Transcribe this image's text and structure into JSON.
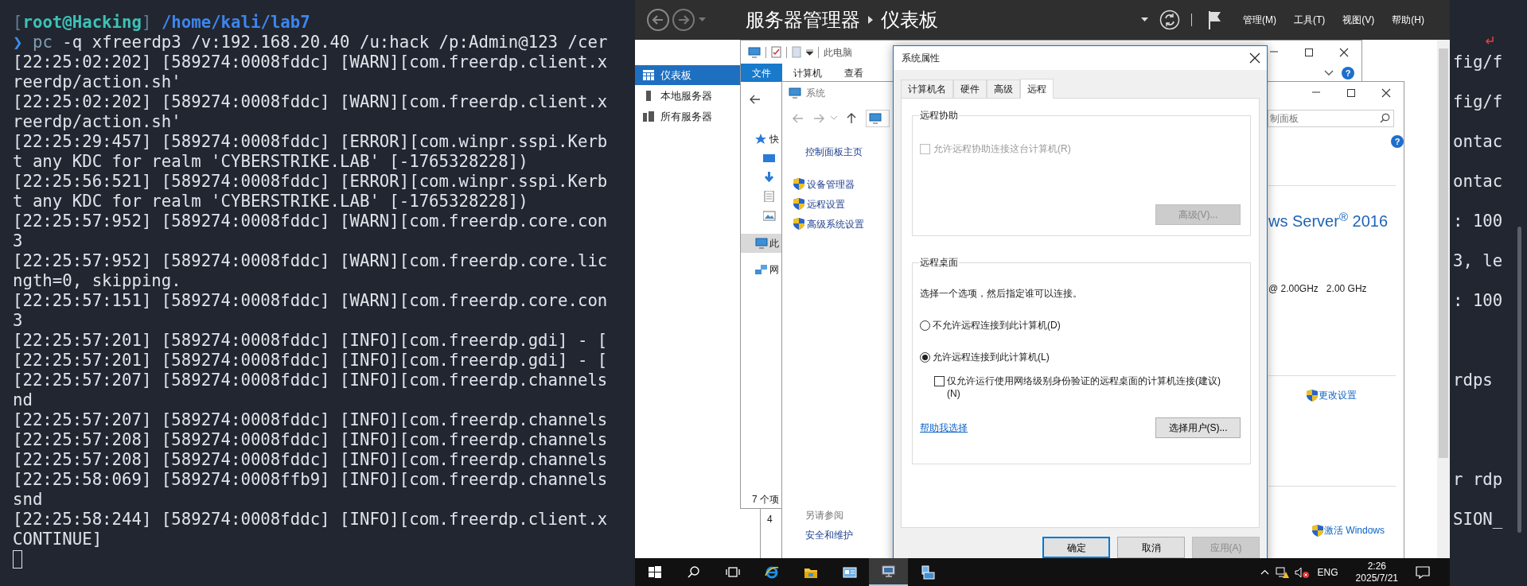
{
  "terminal": {
    "prompt": {
      "open": "[",
      "user": "root@Hacking",
      "close": "]",
      "path": "/home/kali/lab7"
    },
    "command": {
      "symbol": "❯",
      "program": "pc",
      "args": "-q xfreerdp3 /v:192.168.20.40 /u:hack /p:Admin@123 /cer"
    },
    "lines": [
      {
        "text": "[22:25:02:202] [589274:0008fddc] [WARN][com.freerdp.client.x",
        "right": "fig/f"
      },
      {
        "text": "reerdp/action.sh'"
      },
      {
        "text": "[22:25:02:202] [589274:0008fddc] [WARN][com.freerdp.client.x",
        "right": "fig/f"
      },
      {
        "text": "reerdp/action.sh'"
      },
      {
        "text": "[22:25:29:457] [589274:0008fddc] [ERROR][com.winpr.sspi.Kerb",
        "right": "ontac"
      },
      {
        "text": "t any KDC for realm 'CYBERSTRIKE.LAB' [-1765328228])"
      },
      {
        "text": "[22:25:56:521] [589274:0008fddc] [ERROR][com.winpr.sspi.Kerb",
        "right": "ontac"
      },
      {
        "text": "t any KDC for realm 'CYBERSTRIKE.LAB' [-1765328228])"
      },
      {
        "text": "[22:25:57:952] [589274:0008fddc] [WARN][com.freerdp.core.con",
        "right": ": 100"
      },
      {
        "text": "3"
      },
      {
        "text": "[22:25:57:952] [589274:0008fddc] [WARN][com.freerdp.core.lic",
        "right": "3, le"
      },
      {
        "text": "ngth=0, skipping."
      },
      {
        "text": "[22:25:57:151] [589274:0008fddc] [WARN][com.freerdp.core.con",
        "right": ": 100"
      },
      {
        "text": "3"
      },
      {
        "text": "[22:25:57:201] [589274:0008fddc] [INFO][com.freerdp.gdi] - ["
      },
      {
        "text": "[22:25:57:201] [589274:0008fddc] [INFO][com.freerdp.gdi] - ["
      },
      {
        "text": "[22:25:57:207] [589274:0008fddc] [INFO][com.freerdp.channels",
        "right": "rdps"
      },
      {
        "text": "nd"
      },
      {
        "text": "[22:25:57:207] [589274:0008fddc] [INFO][com.freerdp.channels"
      },
      {
        "text": "[22:25:57:208] [589274:0008fddc] [INFO][com.freerdp.channels"
      },
      {
        "text": "[22:25:57:208] [589274:0008fddc] [INFO][com.freerdp.channels"
      },
      {
        "text": "[22:25:58:069] [589274:0008ffb9] [INFO][com.freerdp.channels",
        "right": "r rdp"
      },
      {
        "text": "snd"
      },
      {
        "text": "[22:25:58:244] [589274:0008fddc] [INFO][com.freerdp.client.x",
        "right": "SION_"
      },
      {
        "text": "CONTINUE]"
      }
    ]
  },
  "server_manager": {
    "title": "服务器管理器",
    "page": "仪表板",
    "menus": [
      "管理(M)",
      "工具(T)",
      "视图(V)",
      "帮助(H)"
    ],
    "nav": [
      {
        "label": "仪表板",
        "kind": "dashboard",
        "selected": true
      },
      {
        "label": "本地服务器",
        "kind": "server",
        "selected": false
      },
      {
        "label": "所有服务器",
        "kind": "servers",
        "selected": false
      }
    ]
  },
  "behind_window": {
    "text": "4"
  },
  "explorer": {
    "title": "此电脑",
    "ribbon_tabs": [
      {
        "label": "文件",
        "selected": true
      },
      {
        "label": "计算机",
        "selected": false
      },
      {
        "label": "查看",
        "selected": false
      }
    ],
    "nav_items": [
      {
        "kind": "quick",
        "label": "快",
        "selected": false
      },
      {
        "kind": "desktop",
        "selected": false
      },
      {
        "kind": "downloads",
        "selected": false
      },
      {
        "kind": "documents",
        "selected": false
      },
      {
        "kind": "pictures",
        "selected": false
      },
      {
        "kind": "pc",
        "label": "此",
        "selected": true
      },
      {
        "kind": "network",
        "label": "网",
        "selected": false
      }
    ],
    "help": "?",
    "status": "7 个项"
  },
  "system_window": {
    "title": "系统",
    "search_placeholder": "制面板",
    "home_link": "控制面板主页",
    "tasks": [
      "设备管理器",
      "远程设置",
      "高级系统设置"
    ],
    "see_also_title": "另请参阅",
    "see_also": [
      "安全和维护"
    ],
    "help": "?",
    "edition": "ws Server$^{®}$ 2016",
    "cpu": "@ 2.00GHz   2.00 GHz",
    "change_settings": "更改设置",
    "activate": "激活 Windows"
  },
  "dialog": {
    "title": "系统属性",
    "tabs": [
      {
        "label": "计算机名",
        "selected": false
      },
      {
        "label": "硬件",
        "selected": false
      },
      {
        "label": "高级",
        "selected": false
      },
      {
        "label": "远程",
        "selected": true
      }
    ],
    "remote_assistance": {
      "legend": "远程协助",
      "checkbox": {
        "label": "允许远程协助连接这台计算机(R)",
        "checked": false,
        "disabled": true
      },
      "advanced_button": {
        "label": "高级(V)...",
        "disabled": true
      }
    },
    "remote_desktop": {
      "legend": "远程桌面",
      "hint": "选择一个选项，然后指定谁可以连接。",
      "options": [
        {
          "label": "不允许远程连接到此计算机(D)",
          "selected": false
        },
        {
          "label": "允许远程连接到此计算机(L)",
          "selected": true
        }
      ],
      "nla": {
        "label": "仅允许运行使用网络级别身份验证的远程桌面的计算机连接(建议)(N)",
        "checked": false
      },
      "help_link": "帮助我选择",
      "select_users": "选择用户(S)..."
    },
    "buttons": [
      {
        "label": "确定",
        "kind": "default"
      },
      {
        "label": "取消",
        "kind": "normal"
      },
      {
        "label": "应用(A)",
        "kind": "disabled"
      }
    ]
  },
  "taskbar": {
    "apps": [
      {
        "kind": "start",
        "active": false
      },
      {
        "kind": "search",
        "active": false
      },
      {
        "kind": "task-view",
        "active": false
      },
      {
        "kind": "browser",
        "active": false
      },
      {
        "kind": "folder",
        "active": false
      },
      {
        "kind": "control-panel",
        "active": false
      },
      {
        "kind": "remote-desktop",
        "active": true
      },
      {
        "kind": "server-manager",
        "active": false
      }
    ],
    "language": "ENG",
    "time": "2:26",
    "date": "2025/7/21"
  }
}
